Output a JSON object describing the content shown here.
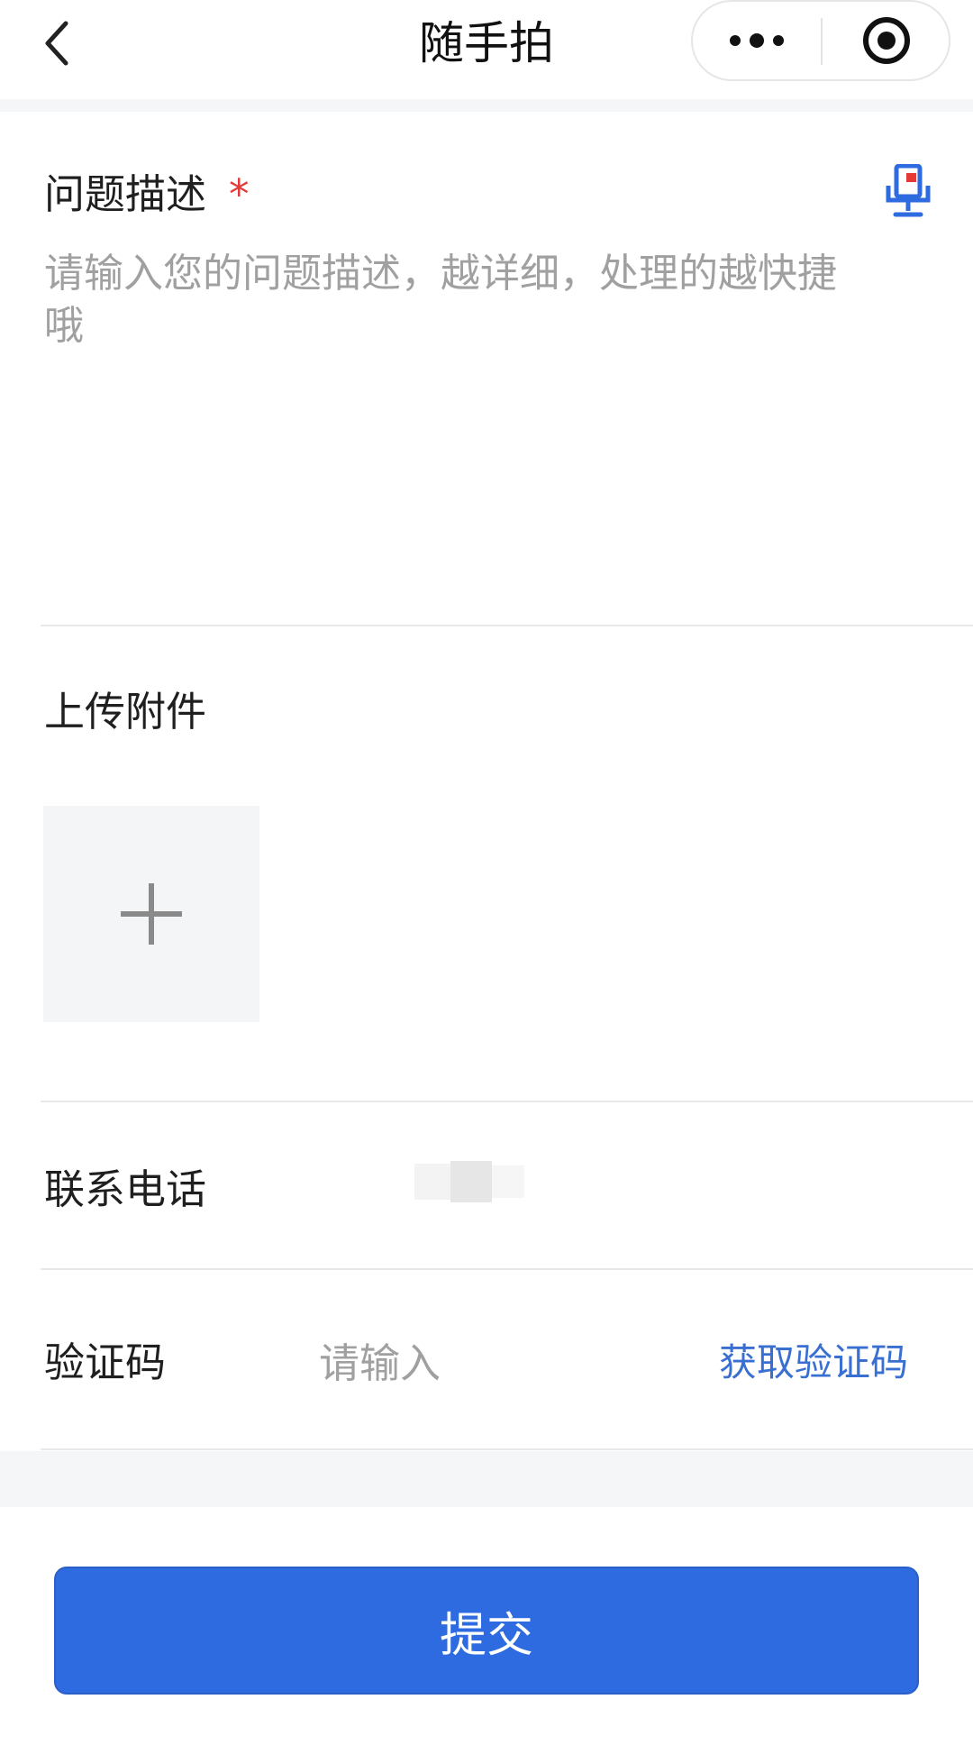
{
  "navbar": {
    "title": "随手拍",
    "back_icon": "chevron-left-icon",
    "more_icon": "more-dots-icon",
    "target_icon": "target-icon"
  },
  "description": {
    "label": "问题描述",
    "required_mark": "*",
    "placeholder": "请输入您的问题描述，越详细，处理的越快捷哦",
    "value": "",
    "mic_icon": "voice-input-icon",
    "accent_color": "#2e6be1"
  },
  "upload": {
    "label": "上传附件",
    "add_icon": "plus-icon"
  },
  "phone": {
    "label": "联系电话",
    "value": ""
  },
  "verification": {
    "label": "验证码",
    "placeholder": "请输入",
    "value": "",
    "get_code_label": "获取验证码",
    "link_color": "#3a6fd2"
  },
  "submit": {
    "label": "提交",
    "color": "#2e6be1"
  }
}
